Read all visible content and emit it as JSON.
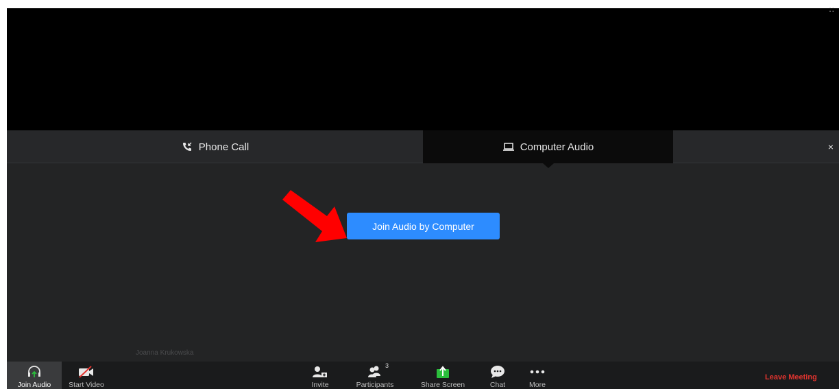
{
  "window": {
    "corner_indicator": "::"
  },
  "audio_dialog": {
    "tabs": [
      {
        "label": "Phone Call",
        "icon": "phone-incoming-icon",
        "active": false
      },
      {
        "label": "Computer Audio",
        "icon": "laptop-icon",
        "active": true
      }
    ],
    "close_label": "×",
    "join_button_label": "Join Audio by Computer",
    "annotation_arrow_color": "#ff0000",
    "accent_color": "#2d8cff"
  },
  "participant": {
    "name": "Joanna Krukowska"
  },
  "toolbar": {
    "join_audio_label": "Join Audio",
    "start_video_label": "Start Video",
    "invite_label": "Invite",
    "participants_label": "Participants",
    "participants_count": "3",
    "share_screen_label": "Share Screen",
    "chat_label": "Chat",
    "more_label": "More",
    "leave_label": "Leave Meeting",
    "leave_color": "#e3342f",
    "share_color": "#2bbf3c"
  }
}
